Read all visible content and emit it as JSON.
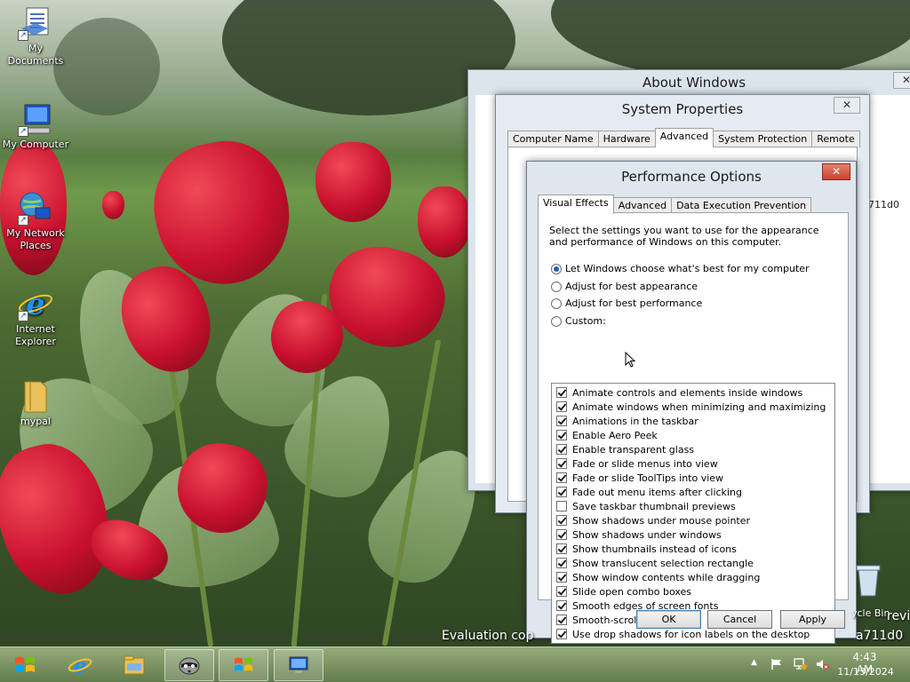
{
  "desktop": {
    "icons": [
      {
        "label": "My Documents"
      },
      {
        "label": "My Computer"
      },
      {
        "label": "My Network Places"
      },
      {
        "label": "Internet Explorer"
      },
      {
        "label": "mypal"
      }
    ],
    "edge_label": "ycle Bin",
    "preview_text": "review",
    "watermark_left": "Evaluation cop",
    "watermark_right": "a711d0",
    "side_text": "711d0"
  },
  "about_window": {
    "title": "About Windows",
    "close": "✕"
  },
  "system_properties": {
    "title": "System Properties",
    "close": "✕",
    "tabs": [
      {
        "label": "Computer Name"
      },
      {
        "label": "Hardware"
      },
      {
        "label": "Advanced"
      },
      {
        "label": "System Protection"
      },
      {
        "label": "Remote"
      }
    ]
  },
  "performance_options": {
    "title": "Performance Options",
    "close": "✕",
    "tabs": [
      {
        "label": "Visual Effects"
      },
      {
        "label": "Advanced"
      },
      {
        "label": "Data Execution Prevention"
      }
    ],
    "description": "Select the settings you want to use for the appearance and performance of Windows on this computer.",
    "radios": [
      {
        "label": "Let Windows choose what's best for my computer",
        "checked": true
      },
      {
        "label": "Adjust for best appearance",
        "checked": false
      },
      {
        "label": "Adjust for best performance",
        "checked": false
      },
      {
        "label": "Custom:",
        "checked": false
      }
    ],
    "effects": [
      {
        "label": "Animate controls and elements inside windows",
        "checked": true
      },
      {
        "label": "Animate windows when minimizing and maximizing",
        "checked": true
      },
      {
        "label": "Animations in the taskbar",
        "checked": true
      },
      {
        "label": "Enable Aero Peek",
        "checked": true
      },
      {
        "label": "Enable transparent glass",
        "checked": true
      },
      {
        "label": "Fade or slide menus into view",
        "checked": true
      },
      {
        "label": "Fade or slide ToolTips into view",
        "checked": true
      },
      {
        "label": "Fade out menu items after clicking",
        "checked": true
      },
      {
        "label": "Save taskbar thumbnail previews",
        "checked": false
      },
      {
        "label": "Show shadows under mouse pointer",
        "checked": true
      },
      {
        "label": "Show shadows under windows",
        "checked": true
      },
      {
        "label": "Show thumbnails instead of icons",
        "checked": true
      },
      {
        "label": "Show translucent selection rectangle",
        "checked": true
      },
      {
        "label": "Show window contents while dragging",
        "checked": true
      },
      {
        "label": "Slide open combo boxes",
        "checked": true
      },
      {
        "label": "Smooth edges of screen fonts",
        "checked": true
      },
      {
        "label": "Smooth-scroll list boxes",
        "checked": true
      },
      {
        "label": "Use drop shadows for icon labels on the desktop",
        "checked": true
      }
    ],
    "buttons": {
      "ok": "OK",
      "cancel": "Cancel",
      "apply": "Apply"
    }
  },
  "taskbar": {
    "items": [
      {
        "icon": "internet-explorer-icon"
      },
      {
        "icon": "file-explorer-icon"
      },
      {
        "icon": "raccoon-app-icon"
      },
      {
        "icon": "windows-flag-icon"
      },
      {
        "icon": "system-monitor-icon"
      }
    ],
    "tray": {
      "time": "4:43 AM",
      "date": "11/13/2024",
      "chevron": "▲"
    }
  },
  "colors": {
    "accent": "#1f5fbf",
    "close_red": "#c7432d"
  }
}
